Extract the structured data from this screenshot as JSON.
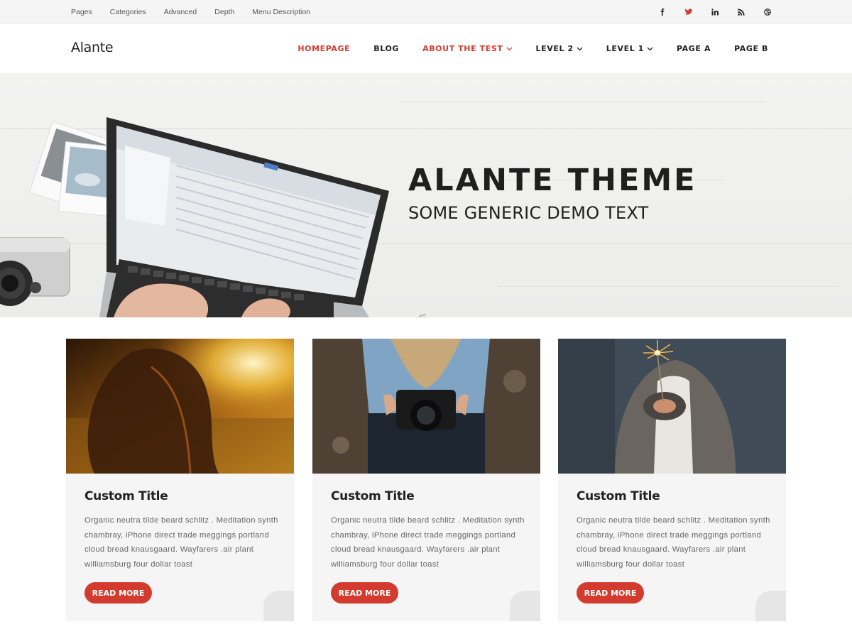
{
  "top_nav": {
    "items": [
      "Pages",
      "Categories",
      "Advanced",
      "Depth",
      "Menu Description"
    ]
  },
  "social": [
    {
      "icon": "facebook-icon",
      "color": "#222222"
    },
    {
      "icon": "twitter-icon",
      "color": "#d33b2f"
    },
    {
      "icon": "linkedin-icon",
      "color": "#222222"
    },
    {
      "icon": "rss-icon",
      "color": "#222222"
    },
    {
      "icon": "dribbble-icon",
      "color": "#222222"
    }
  ],
  "header": {
    "logo": "Alante",
    "nav": [
      {
        "label": "HOMEPAGE",
        "active": true
      },
      {
        "label": "BLOG"
      },
      {
        "label": "ABOUT THE TEST",
        "active": true,
        "dropdown": true
      },
      {
        "label": "LEVEL 2",
        "dropdown": true
      },
      {
        "label": "LEVEL 1",
        "dropdown": true
      },
      {
        "label": "PAGE A"
      },
      {
        "label": "PAGE B"
      }
    ]
  },
  "hero": {
    "title": "ALANTE THEME",
    "subtitle": "SOME GENERIC DEMO TEXT"
  },
  "cards": [
    {
      "title": "Custom Title",
      "text": "Organic neutra tilde beard schlitz . Meditation synth chambray, iPhone direct trade meggings portland cloud bread knausgaard. Wayfarers .air plant williamsburg four dollar toast",
      "button": "READ MORE"
    },
    {
      "title": "Custom Title",
      "text": "Organic neutra tilde beard schlitz . Meditation synth chambray, iPhone direct trade meggings portland cloud bread knausgaard. Wayfarers .air plant williamsburg four dollar toast",
      "button": "READ MORE"
    },
    {
      "title": "Custom Title",
      "text": "Organic neutra tilde beard schlitz . Meditation synth chambray, iPhone direct trade meggings portland cloud bread knausgaard. Wayfarers .air plant williamsburg four dollar toast",
      "button": "READ MORE"
    }
  ],
  "colors": {
    "accent": "#d33b2f",
    "text": "#222222",
    "body_text": "#666666",
    "card_bg": "#f5f5f5"
  }
}
